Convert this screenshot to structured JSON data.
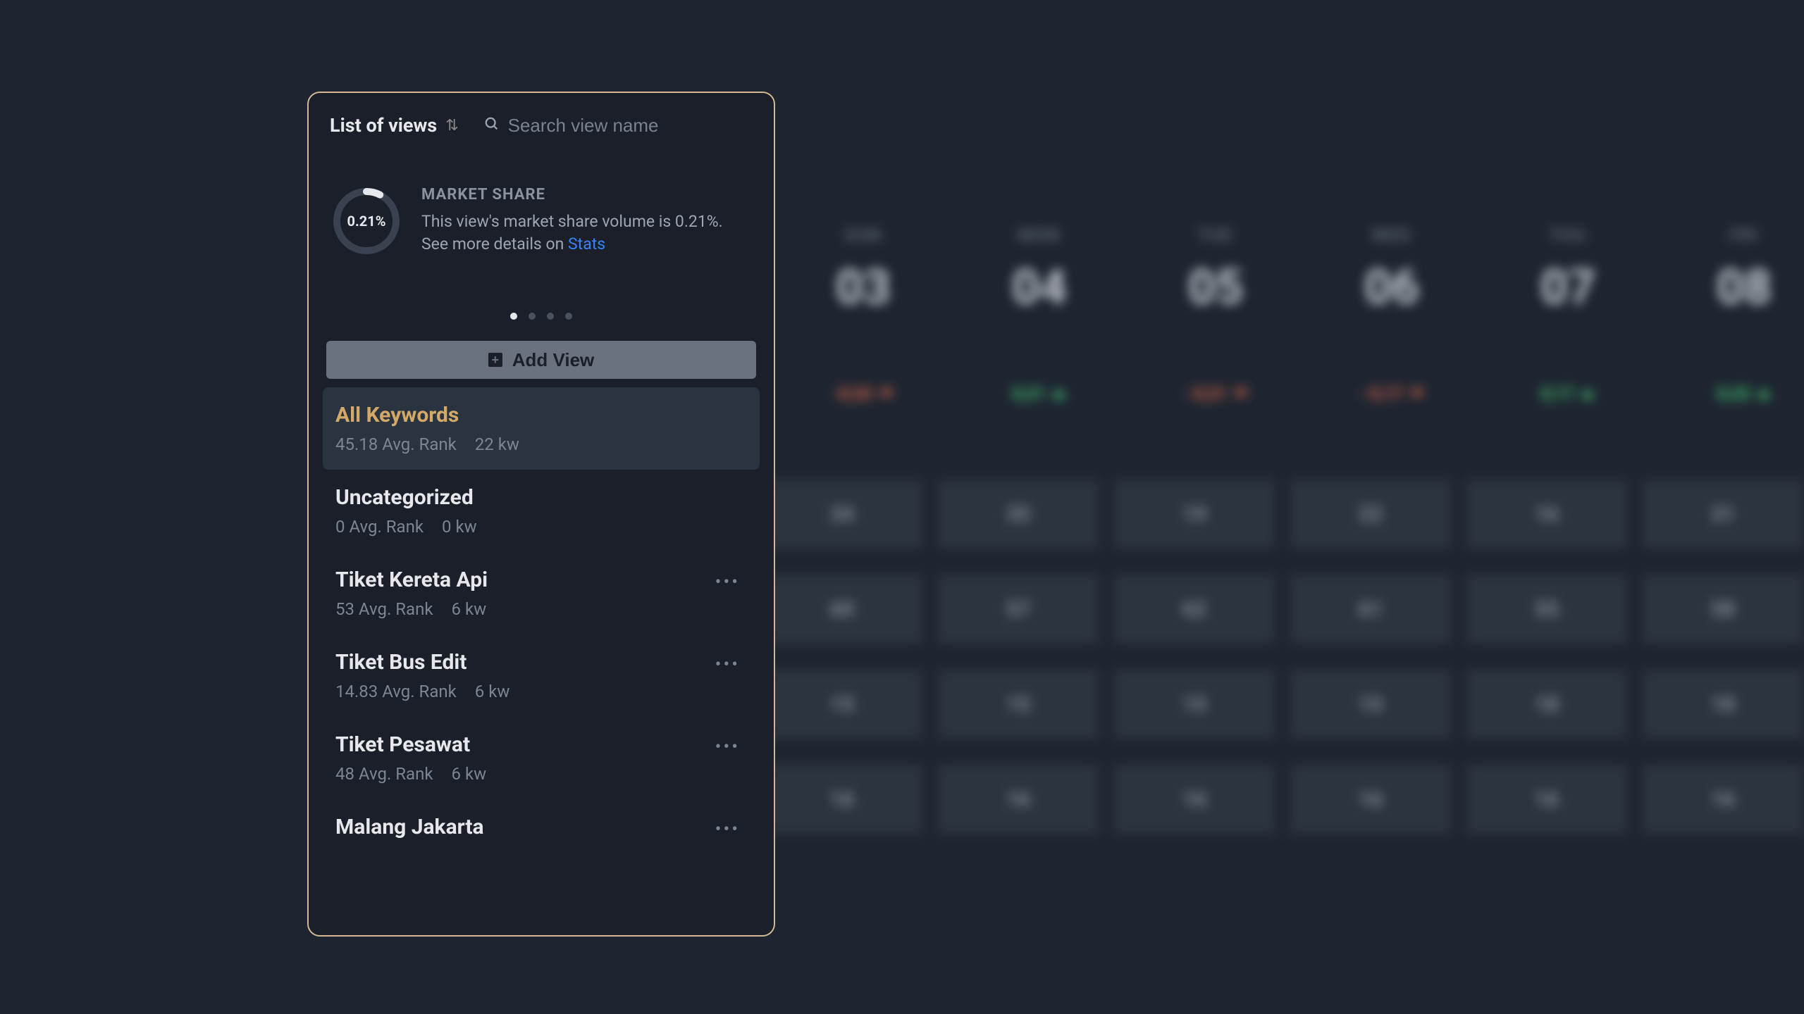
{
  "panel": {
    "title": "List of views",
    "search_placeholder": "Search view name"
  },
  "market_share": {
    "title": "MARKET SHARE",
    "value": "0.21%",
    "description_pre": "This view's market share volume is 0.21%. See more details on ",
    "link_text": "Stats"
  },
  "add_view_label": "Add View",
  "views": [
    {
      "name": "All Keywords",
      "rank": "45.18 Avg. Rank",
      "kw": "22 kw",
      "active": true,
      "menu": false
    },
    {
      "name": "Uncategorized",
      "rank": "0 Avg. Rank",
      "kw": "0 kw",
      "active": false,
      "menu": false
    },
    {
      "name": "Tiket Kereta Api",
      "rank": "53 Avg. Rank",
      "kw": "6 kw",
      "active": false,
      "menu": true
    },
    {
      "name": "Tiket Bus Edit",
      "rank": "14.83 Avg. Rank",
      "kw": "6 kw",
      "active": false,
      "menu": true
    },
    {
      "name": "Tiket Pesawat",
      "rank": "48 Avg. Rank",
      "kw": "6 kw",
      "active": false,
      "menu": true
    },
    {
      "name": "Malang Jakarta",
      "rank": "",
      "kw": "",
      "active": false,
      "menu": true
    }
  ],
  "calendar": {
    "days": [
      {
        "label": "SUN",
        "num": "03",
        "trend": "-0,33",
        "dir": "down"
      },
      {
        "label": "MON",
        "num": "04",
        "trend": "0,21",
        "dir": "up"
      },
      {
        "label": "TUE",
        "num": "05",
        "trend": "- 0,21",
        "dir": "down"
      },
      {
        "label": "WED",
        "num": "06",
        "trend": "- 0,17",
        "dir": "down"
      },
      {
        "label": "THU",
        "num": "07",
        "trend": "0,17",
        "dir": "up"
      },
      {
        "label": "FRI",
        "num": "08",
        "trend": "0,33",
        "dir": "up"
      }
    ],
    "grid": [
      [
        "34",
        "35",
        "19",
        "22",
        "16",
        "31"
      ],
      [
        "60",
        "57",
        "62",
        "61",
        "55",
        "58"
      ],
      [
        "15",
        "15",
        "15",
        "15",
        "18",
        "18"
      ],
      [
        "16",
        "16",
        "16",
        "16",
        "16",
        "16"
      ]
    ]
  }
}
